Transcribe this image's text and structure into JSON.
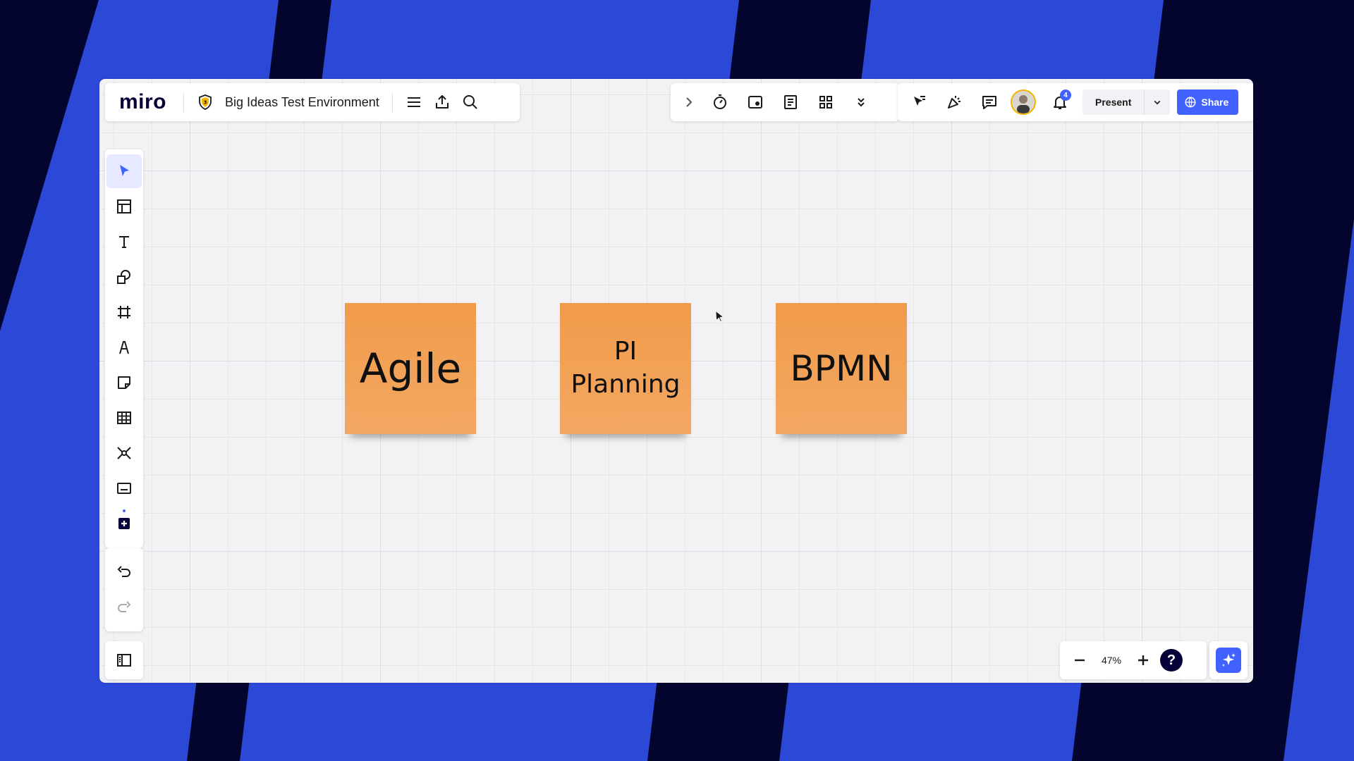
{
  "colors": {
    "backdrop_blue": "#2c48d6",
    "backdrop_dark": "#03052e",
    "canvas": "#f2f2f4",
    "sticky_orange": "#f19b4b",
    "accent": "#4262ff"
  },
  "header": {
    "logo": "miro",
    "board_title": "Big Ideas Test Environment",
    "icons": [
      "shield-badge-icon",
      "menu-icon",
      "export-icon",
      "search-icon"
    ]
  },
  "collab_bar": {
    "icons": [
      "chevron-right-icon",
      "timer-icon",
      "video-chat-icon",
      "notes-icon",
      "apps-grid-icon",
      "chevrons-down-icon"
    ]
  },
  "actions_bar": {
    "notification_count": "4",
    "present_label": "Present",
    "share_label": "Share",
    "icons": [
      "cursor-follow-icon",
      "celebrate-icon",
      "comment-icon",
      "avatar",
      "bell-icon",
      "chevron-down-icon",
      "globe-icon"
    ]
  },
  "toolbar": {
    "tools": [
      "select-tool",
      "templates-tool",
      "text-tool",
      "shapes-tool",
      "frame-tool",
      "pen-tool",
      "sticky-note-tool",
      "table-tool",
      "mindmap-tool",
      "card-tool",
      "more-apps-tool"
    ],
    "history": [
      "undo-button",
      "redo-button"
    ]
  },
  "stickies": [
    {
      "text": "Agile"
    },
    {
      "line1": "PI",
      "line2": "Planning"
    },
    {
      "text": "BPMN"
    }
  ],
  "zoom": {
    "value": "47%",
    "help": "?"
  }
}
